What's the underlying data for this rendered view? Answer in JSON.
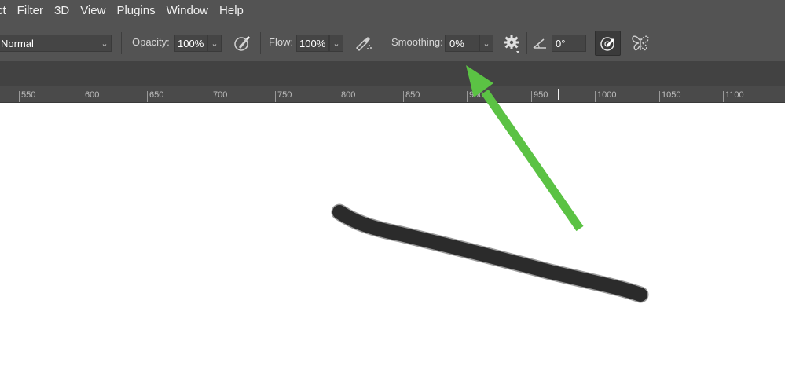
{
  "menubar": {
    "items": [
      {
        "label": "ct"
      },
      {
        "label": "Filter"
      },
      {
        "label": "3D"
      },
      {
        "label": "View"
      },
      {
        "label": "Plugins"
      },
      {
        "label": "Window"
      },
      {
        "label": "Help"
      }
    ]
  },
  "options": {
    "mode_value": "Normal",
    "opacity_label": "Opacity:",
    "opacity_value": "100%",
    "flow_label": "Flow:",
    "flow_value": "100%",
    "smoothing_label": "Smoothing:",
    "smoothing_value": "0%",
    "angle_value": "0°"
  },
  "ruler": {
    "ticks": [
      "550",
      "600",
      "650",
      "700",
      "750",
      "800",
      "850",
      "900",
      "950",
      "1000",
      "1050",
      "1100"
    ]
  },
  "annotation": {
    "arrow_color": "#5bc244",
    "stroke_color": "#2b2b2b"
  }
}
